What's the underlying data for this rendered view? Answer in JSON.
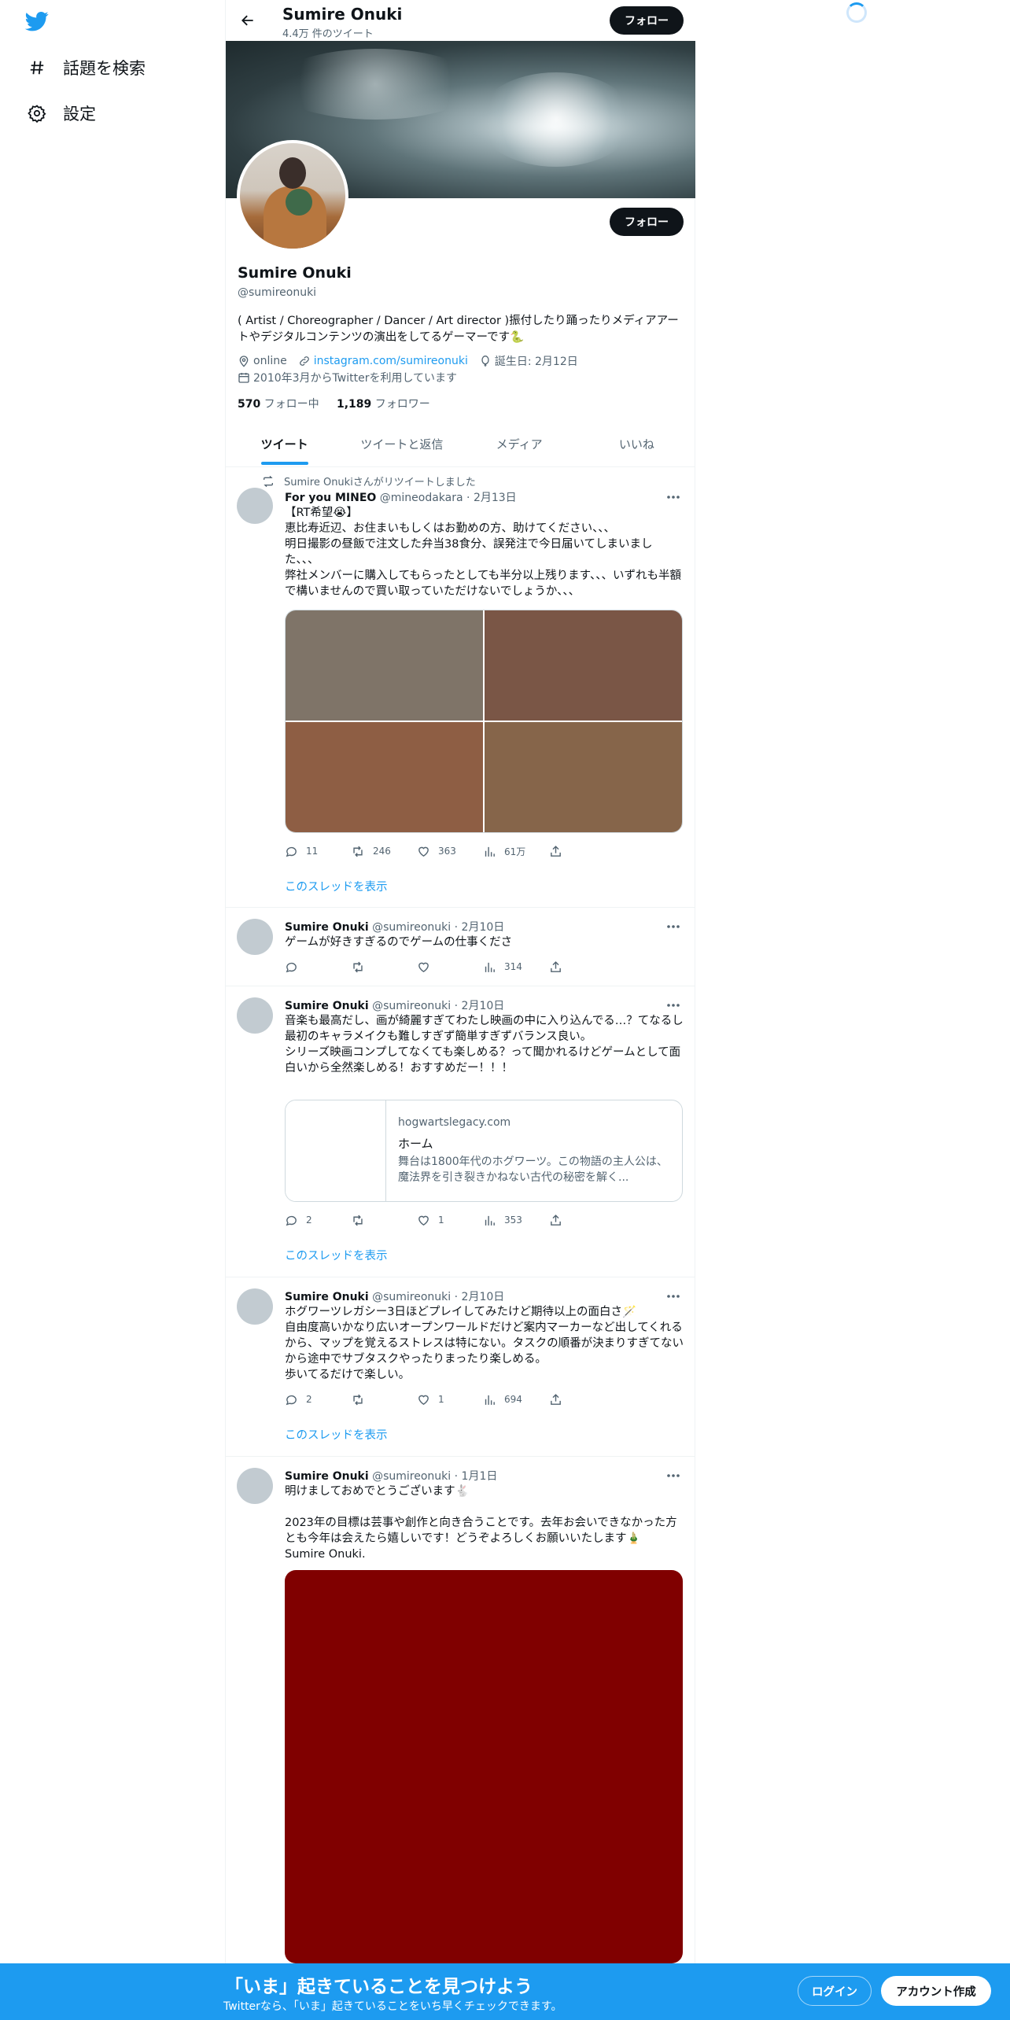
{
  "sidebar": {
    "items": [
      {
        "icon": "hashtag-icon",
        "label": "話題を検索"
      },
      {
        "icon": "gear-icon",
        "label": "設定"
      }
    ]
  },
  "header": {
    "name": "Sumire Onuki",
    "tweet_count": "4.4万 件のツイート",
    "follow_label": "フォロー"
  },
  "profile": {
    "name": "Sumire Onuki",
    "handle": "@sumireonuki",
    "bio": "( Artist / Choreographer / Dancer / Art director )振付したり踊ったりメディアアートやデジタルコンテンツの演出をしてるゲーマーです🐍",
    "location": "online",
    "website": "instagram.com/sumireonuki",
    "birthday": "誕生日: 2月12日",
    "joined": "2010年3月からTwitterを利用しています",
    "following_count": "570",
    "following_label": " フォロー中",
    "followers_count": "1,189",
    "followers_label": " フォロワー",
    "follow_label": "フォロー"
  },
  "tabs": [
    "ツイート",
    "ツイートと返信",
    "メディア",
    "いいね"
  ],
  "tweets": [
    {
      "retweeted_by": "Sumire Onukiさんがリツイートしました",
      "name": "For you MINEO",
      "handle": "@mineodakara",
      "date": "2月13日",
      "text": "【RT希望😭】\n恵比寿近辺、お住まいもしくはお勤めの方、助けてください、、、\n明日撮影の昼飯で注文した弁当38食分、誤発注で今日届いてしまいました、、、\n弊社メンバーに購入してもらったとしても半分以上残ります、、、いずれも半額で構いませんので買い取っていただけないでしょうか、、、",
      "images": [
        "#7f7468",
        "#7a5646",
        "#8e5e44",
        "#86654a"
      ],
      "replies": "11",
      "retweets": "246",
      "likes": "363",
      "views": "61万",
      "thread": "このスレッドを表示"
    },
    {
      "name": "Sumire Onuki",
      "handle": "@sumireonuki",
      "date": "2月10日",
      "text": "ゲームが好きすぎるのでゲームの仕事くださ",
      "replies": "",
      "retweets": "",
      "likes": "",
      "views": "314"
    },
    {
      "name": "Sumire Onuki",
      "handle": "@sumireonuki",
      "date": "2月10日",
      "text": "音楽も最高だし、画が綺麗すぎてわたし映画の中に入り込んでる…？てなるし\n最初のキャラメイクも難しすぎず簡単すぎずバランス良い。\nシリーズ映画コンプしてなくても楽しめる？って聞かれるけどゲームとして面白いから全然楽しめる！おすすめだー！！！",
      "card": {
        "domain": "hogwartslegacy.com",
        "title": "ホーム",
        "desc": "舞台は1800年代のホグワーツ。この物語の主人公は、魔法界を引き裂きかねない古代の秘密を解く..."
      },
      "replies": "2",
      "retweets": "",
      "likes": "1",
      "views": "353",
      "thread": "このスレッドを表示"
    },
    {
      "name": "Sumire Onuki",
      "handle": "@sumireonuki",
      "date": "2月10日",
      "text": "ホグワーツレガシー3日ほどプレイしてみたけど期待以上の面白さ🪄\n自由度高いかなり広いオープンワールドだけど案内マーカーなど出してくれるから、マップを覚えるストレスは特にない。タスクの順番が決まりすぎてないから途中でサブタスクやったりまったり楽しめる。\n歩いてるだけで楽しい。",
      "replies": "2",
      "retweets": "",
      "likes": "1",
      "views": "694",
      "thread": "このスレッドを表示"
    },
    {
      "name": "Sumire Onuki",
      "handle": "@sumireonuki",
      "date": "1月1日",
      "text": "明けましておめでとうございます🐇\n\n2023年の目標は芸事や創作と向き合うことです。去年お会いできなかった方とも今年は会えたら嬉しいです！どうぞよろしくお願いいたします🎍\nSumire Onuki.",
      "image_color": "#800000"
    }
  ],
  "bottom": {
    "title": "「いま」起きていることを見つけよう",
    "subtitle": "Twitterなら、「いま」起きていることをいち早くチェックできます。",
    "login": "ログイン",
    "signup": "アカウント作成"
  },
  "colors": {
    "accent": "#1d9bf0",
    "text": "#0f1419",
    "muted": "#536471"
  }
}
